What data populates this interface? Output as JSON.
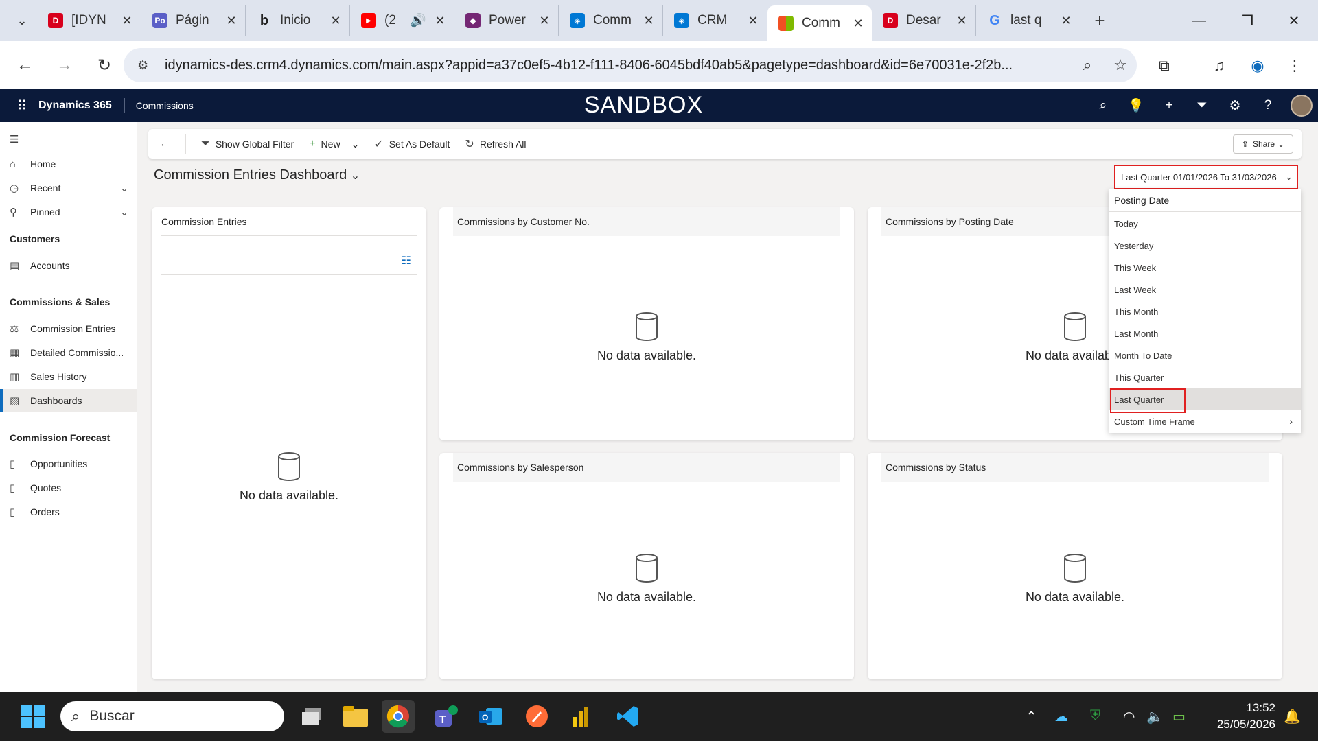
{
  "browser": {
    "tabs": [
      {
        "title": "[IDYN",
        "color": "#d8001c",
        "glyph": "D"
      },
      {
        "title": "Págin",
        "color": "#5b5fc7",
        "glyph": "Po"
      },
      {
        "title": "Inicio",
        "color": "#ffffff",
        "glyph": "b"
      },
      {
        "title": "(2",
        "color": "#ff0000",
        "glyph": "▶"
      },
      {
        "title": "Power",
        "color": "#742774",
        "glyph": "◆"
      },
      {
        "title": "Comm",
        "color": "#0078d4",
        "glyph": "◈"
      },
      {
        "title": "CRM",
        "color": "#0078d4",
        "glyph": "◈"
      },
      {
        "title": "Comm",
        "color": "#f25022",
        "glyph": "▦"
      },
      {
        "title": "Desar",
        "color": "#d8001c",
        "glyph": "D"
      },
      {
        "title": "last q",
        "color": "#ffffff",
        "glyph": "G"
      }
    ],
    "url": "idynamics-des.crm4.dynamics.com/main.aspx?appid=a37c0ef5-4b12-f111-8406-6045bdf40ab5&pagetype=dashboard&id=6e70031e-2f2b..."
  },
  "header": {
    "brand": "Dynamics 365",
    "app": "Commissions",
    "environment": "SANDBOX"
  },
  "sidebar": {
    "home": "Home",
    "recent": "Recent",
    "pinned": "Pinned",
    "customers_heading": "Customers",
    "accounts": "Accounts",
    "commissions_heading": "Commissions & Sales",
    "commission_entries": "Commission Entries",
    "detailed": "Detailed Commissio...",
    "sales_history": "Sales History",
    "dashboards": "Dashboards",
    "forecast_heading": "Commission Forecast",
    "opportunities": "Opportunities",
    "quotes": "Quotes",
    "orders": "Orders"
  },
  "commandbar": {
    "show_filter": "Show Global Filter",
    "new": "New",
    "set_default": "Set As Default",
    "refresh": "Refresh All",
    "share": "Share"
  },
  "dashboard": {
    "title": "Commission Entries Dashboard",
    "empty_text": "No data available.",
    "panels": {
      "entries": "Commission Entries",
      "by_customer": "Commissions by Customer No.",
      "by_posting_date": "Commissions by Posting Date",
      "by_salesperson": "Commissions by Salesperson",
      "by_status": "Commissions by Status"
    }
  },
  "timeframe": {
    "selected": "Last Quarter 01/01/2026 To 31/03/2026",
    "heading": "Posting Date",
    "options": [
      "Today",
      "Yesterday",
      "This Week",
      "Last Week",
      "This Month",
      "Last Month",
      "Month To Date",
      "This Quarter",
      "Last Quarter",
      "Custom Time Frame"
    ],
    "selected_option": "Last Quarter"
  },
  "taskbar": {
    "search_placeholder": "Buscar",
    "time": "13:52",
    "date": "25/05/2026"
  },
  "colors": {
    "header_bg": "#0b1a3a",
    "accent": "#0f6cbd",
    "highlight_border": "#e02020"
  }
}
